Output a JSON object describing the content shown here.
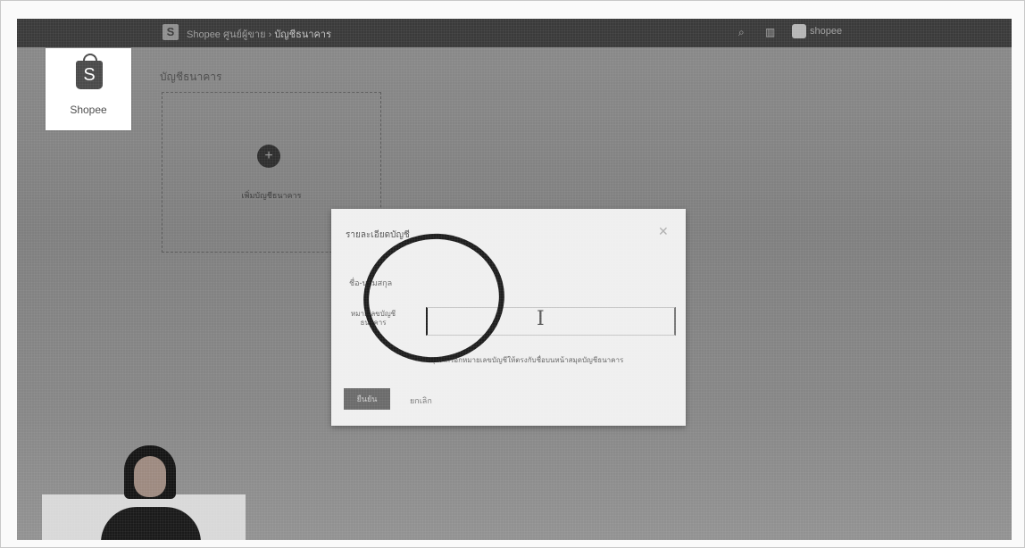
{
  "topbar": {
    "logo_letter": "S",
    "breadcrumb_prefix": "Shopee ศูนย์ผู้ขาย",
    "breadcrumb_current": "บัญชีธนาคาร",
    "icons": [
      "search-icon",
      "grid-icon",
      "user-icon"
    ],
    "user_name": "shopee"
  },
  "logo": {
    "letter": "S",
    "brand": "Shopee"
  },
  "page": {
    "heading": "บัญชีธนาคาร",
    "add_label": "เพิ่มบัญชีธนาคาร",
    "add_icon": "plus-icon"
  },
  "modal": {
    "title": "รายละเอียดบัญชี",
    "close_icon": "close-icon",
    "field1_label": "ชื่อ-นามสกุล",
    "field2_label": "หมายเลขบัญชีธนาคาร",
    "field2_value": "",
    "note": "*กรุณากรอกหมายเลขบัญชีให้ตรงกับชื่อบนหน้าสมุดบัญชีธนาคาร",
    "confirm_label": "ยืนยัน",
    "cancel_label": "ยกเลิก"
  },
  "colors": {
    "topbar": "#3a3a3a",
    "backdrop": "#878787",
    "modal": "#efefef",
    "confirm_button": "#6b6b6b",
    "highlight_ring": "#1e1e1e"
  }
}
